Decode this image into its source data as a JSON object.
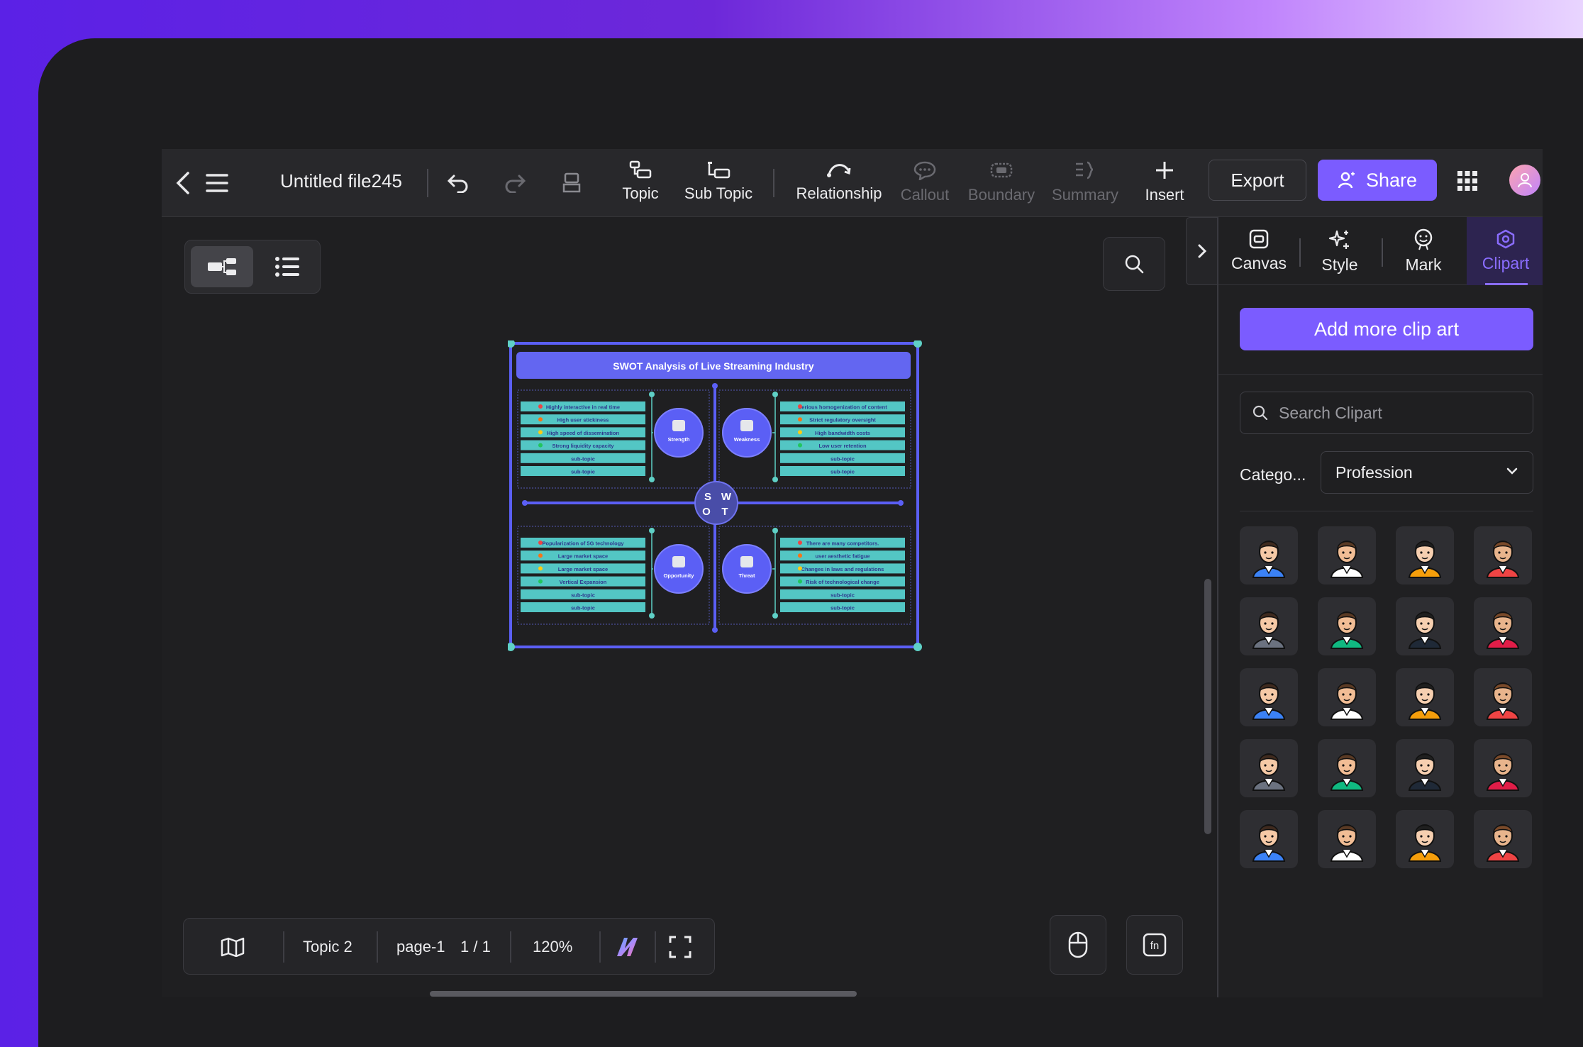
{
  "toolbar": {
    "file_title": "Untitled file245",
    "items": {
      "topic": "Topic",
      "sub_topic": "Sub Topic",
      "relationship": "Relationship",
      "callout": "Callout",
      "boundary": "Boundary",
      "summary": "Summary",
      "insert": "Insert"
    },
    "export_label": "Export",
    "share_label": "Share"
  },
  "panel": {
    "tabs": {
      "canvas": "Canvas",
      "style": "Style",
      "mark": "Mark",
      "clipart": "Clipart"
    },
    "active_tab": "Clipart",
    "add_button": "Add more clip art",
    "search_placeholder": "Search Clipart",
    "category_label": "Catego...",
    "category_value": "Profession"
  },
  "bottom_bar": {
    "topic": "Topic 2",
    "page": "page-1",
    "page_count": "1 / 1",
    "zoom": "120%"
  },
  "diagram": {
    "title": "SWOT Analysis of Live Streaming Industry",
    "center_letters": {
      "s": "S",
      "w": "W",
      "o": "O",
      "t": "T"
    },
    "strength": {
      "label": "Strength",
      "items": [
        "Highly interactive in real time",
        "High user stickiness",
        "High speed of dissemination",
        "Strong liquidity capacity",
        "sub-topic",
        "sub-topic"
      ]
    },
    "weakness": {
      "label": "Weakness",
      "items": [
        "Serious homogenization of content",
        "Strict regulatory oversight",
        "High bandwidth costs",
        "Low user retention",
        "sub-topic",
        "sub-topic"
      ]
    },
    "opportunity": {
      "label": "Opportunity",
      "items": [
        "Popularization of 5G technology",
        "Large market space",
        "Large market space",
        "Vertical Expansion",
        "sub-topic",
        "sub-topic"
      ]
    },
    "threat": {
      "label": "Threat",
      "items": [
        "There are many competitors.",
        "user aesthetic fatigue",
        "Changes in laws and regulations",
        "Risk of technological change",
        "sub-topic",
        "sub-topic"
      ]
    }
  },
  "colors": {
    "accent": "#7b5cff",
    "toolbar_bg": "#28282b",
    "diagram_frame": "#5b5ff5",
    "diagram_item": "#53c6c4",
    "diagram_circle": "#5b5ff5"
  }
}
